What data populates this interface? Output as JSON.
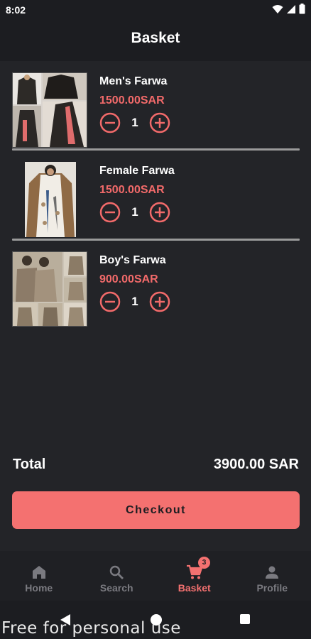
{
  "status_bar": {
    "time": "8:02"
  },
  "header": {
    "title": "Basket"
  },
  "cart": {
    "items": [
      {
        "name": "Men's Farwa",
        "price": "1500.00SAR",
        "quantity": "1"
      },
      {
        "name": "Female Farwa",
        "price": "1500.00SAR",
        "quantity": "1"
      },
      {
        "name": "Boy's Farwa",
        "price": "900.00SAR",
        "quantity": "1"
      }
    ],
    "total_label": "Total",
    "total_value": "3900.00 SAR",
    "checkout_label": "Checkout"
  },
  "bottom_nav": {
    "items": [
      {
        "label": "Home",
        "icon": "home-icon"
      },
      {
        "label": "Search",
        "icon": "search-icon"
      },
      {
        "label": "Basket",
        "icon": "cart-icon",
        "badge": "3",
        "active": true
      },
      {
        "label": "Profile",
        "icon": "person-icon"
      }
    ]
  },
  "watermark": "Free for personal use",
  "colors": {
    "accent": "#f47170",
    "price": "#f26a6a",
    "background": "#232428",
    "bar": "#1c1d21"
  }
}
